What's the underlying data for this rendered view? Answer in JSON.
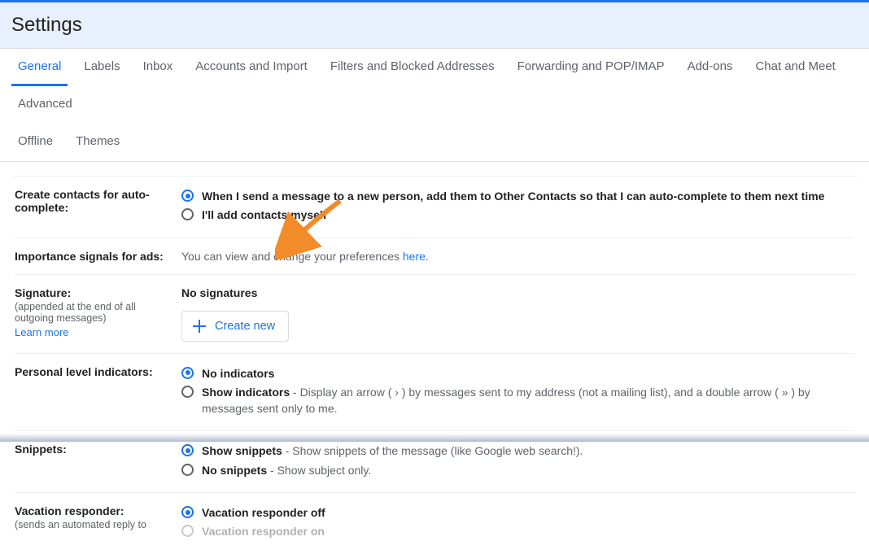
{
  "header": {
    "title": "Settings"
  },
  "tabs": {
    "row1": [
      {
        "label": "General",
        "active": true
      },
      {
        "label": "Labels"
      },
      {
        "label": "Inbox"
      },
      {
        "label": "Accounts and Import"
      },
      {
        "label": "Filters and Blocked Addresses"
      },
      {
        "label": "Forwarding and POP/IMAP"
      },
      {
        "label": "Add-ons"
      },
      {
        "label": "Chat and Meet"
      },
      {
        "label": "Advanced"
      }
    ],
    "row2": [
      {
        "label": "Offline"
      },
      {
        "label": "Themes"
      }
    ]
  },
  "sections": {
    "autocontacts": {
      "label": "Create contacts for auto-complete:",
      "opt1": "When I send a message to a new person, add them to Other Contacts so that I can auto-complete to them next time",
      "opt2": "I'll add contacts myself"
    },
    "ads": {
      "label": "Importance signals for ads:",
      "text_before": "You can view and change your preferences ",
      "link": "here",
      "text_after": "."
    },
    "signature": {
      "label": "Signature:",
      "sub": "(appended at the end of all outgoing messages)",
      "learn": "Learn more",
      "no_sig": "No signatures",
      "create_btn": "Create new"
    },
    "indicators": {
      "label": "Personal level indicators:",
      "opt1_bold": "No indicators",
      "opt2_bold": "Show indicators",
      "opt2_rest": " - Display an arrow ( › ) by messages sent to my address (not a mailing list), and a double arrow ( » ) by messages sent only to me."
    },
    "snippets": {
      "label": "Snippets:",
      "opt1_bold": "Show snippets",
      "opt1_rest": " - Show snippets of the message (like Google web search!).",
      "opt2_bold": "No snippets",
      "opt2_rest": " - Show subject only."
    },
    "vacation": {
      "label": "Vacation responder:",
      "sub": "(sends an automated reply to",
      "opt1_bold": "Vacation responder off",
      "opt2_bold": "Vacation responder on"
    }
  }
}
